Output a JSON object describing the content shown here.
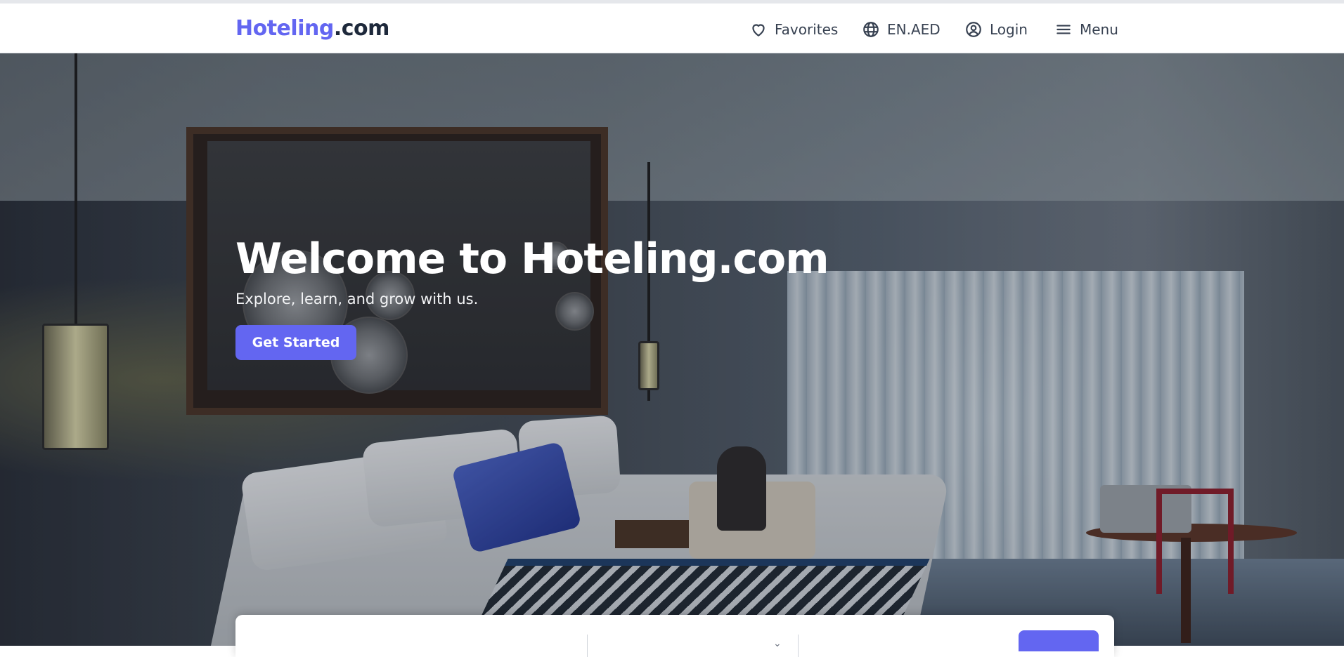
{
  "header": {
    "logo_brand": "Hoteling",
    "logo_tld": ".com",
    "nav": {
      "favorites": "Favorites",
      "language": "EN.AED",
      "login": "Login",
      "menu": "Menu"
    }
  },
  "hero": {
    "title": "Welcome to Hoteling.com",
    "subtitle": "Explore, learn, and grow with us.",
    "cta_label": "Get Started"
  },
  "icons": {
    "favorites": "heart-icon",
    "language": "globe-icon",
    "login": "user-circle-icon",
    "menu": "hamburger-icon"
  },
  "colors": {
    "accent": "#6366f1",
    "logo_dark": "#1e293b",
    "nav_text": "#374151",
    "hero_text": "#ffffff"
  }
}
